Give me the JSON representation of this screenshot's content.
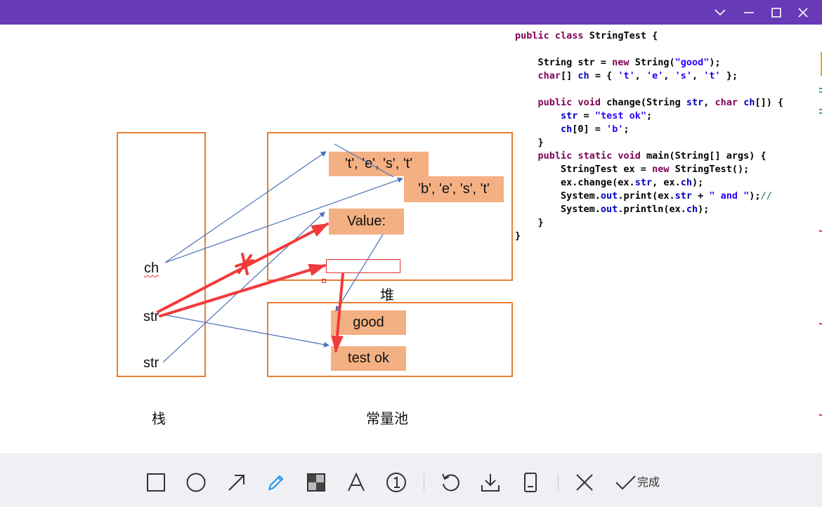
{
  "window": {
    "controls": [
      "chevron-down",
      "minimize",
      "maximize",
      "close"
    ]
  },
  "diagram": {
    "heap_values": [
      "'t', 'e', 's', 't'",
      "'b', 'e', 's', 't'",
      "Value:"
    ],
    "pool_values": [
      "good",
      "test ok"
    ],
    "stack_vars": [
      "ch",
      "str",
      "str"
    ],
    "captions": {
      "heap": "堆",
      "stack": "栈",
      "pool": "常量池"
    }
  },
  "code": {
    "lines": [
      "public class StringTest {",
      "",
      "    String str = new String(\"good\");",
      "    char[] ch = { 't', 'e', 's', 't' };",
      "",
      "    public void change(String str, char ch[]) {",
      "        str = \"test ok\";",
      "        ch[0] = 'b';",
      "    }",
      "    public static void main(String[] args) {",
      "        StringTest ex = new StringTest();",
      "        ex.change(ex.str, ex.ch);",
      "        System.out.print(ex.str + \" and \");//",
      "        System.out.println(ex.ch);",
      "    }",
      "}"
    ]
  },
  "toolbar": {
    "tools": [
      "rectangle",
      "ellipse",
      "arrow",
      "pen",
      "mosaic",
      "text",
      "number",
      "undo",
      "download",
      "pin",
      "cancel",
      "done"
    ],
    "active_tool": "pen",
    "done_label": "完成",
    "accent": "#2196f3"
  },
  "colors": {
    "titlebar": "#673ab7",
    "box_border": "#e87f2e",
    "chip_fill": "#f3b083",
    "thin_arrow": "#4a72b8",
    "thick_arrow": "#f23a3a"
  }
}
